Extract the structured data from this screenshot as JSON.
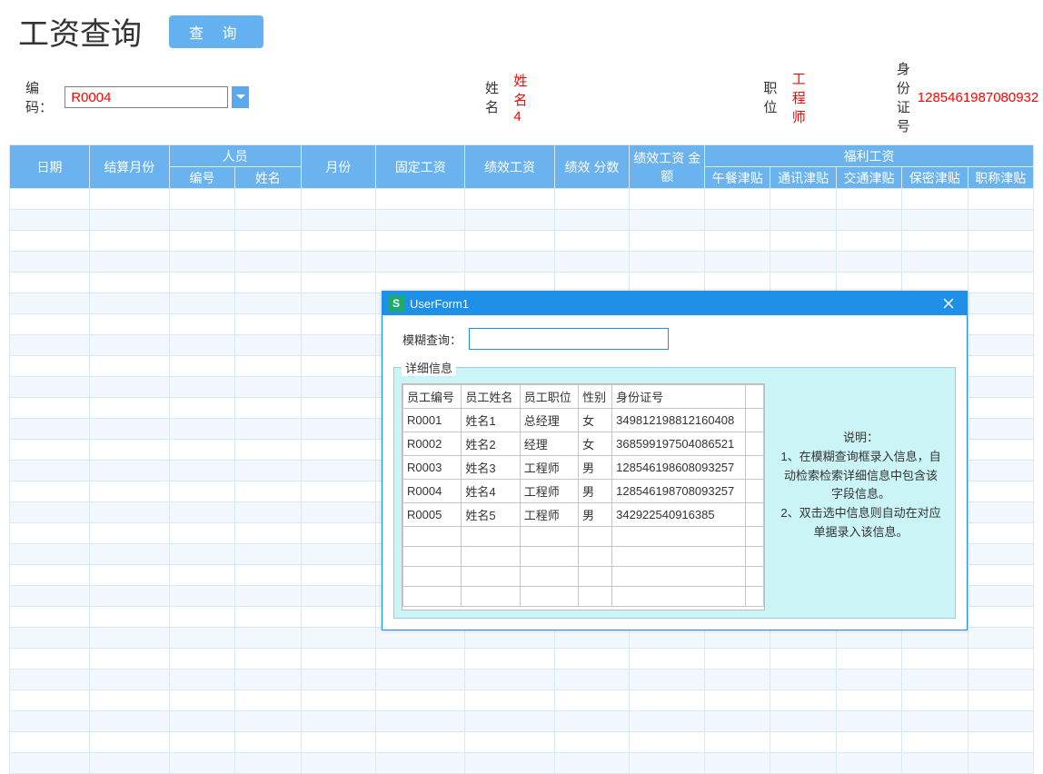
{
  "header": {
    "title": "工资查询",
    "query_button": "查  询"
  },
  "info": {
    "code_label": "编码：",
    "code_value": "R0004",
    "name_label": "姓名",
    "name_value": "姓名4",
    "role_label": "职位",
    "role_value": "工程师",
    "idno_label": "身份证号",
    "idno_value": "1285461987080932"
  },
  "grid": {
    "headers": {
      "date": "日期",
      "settle_month": "结算月份",
      "person": "人员",
      "person_id": "编号",
      "person_name": "姓名",
      "month": "月份",
      "fixed_salary": "固定工资",
      "perf_salary": "绩效工资",
      "perf_score": "绩效\n分数",
      "perf_amount": "绩效工资\n金额",
      "benefit_salary": "福利工资",
      "lunch": "午餐津贴",
      "comm": "通讯津贴",
      "transport": "交通津贴",
      "secret": "保密津贴",
      "title_allow": "职称津贴"
    },
    "empty_rows": 28
  },
  "dialog": {
    "title": "UserForm1",
    "icon_letter": "S",
    "fuzzy_label": "模糊查询：",
    "fuzzy_value": "",
    "detail_legend": "详细信息",
    "columns": [
      "员工编号",
      "员工姓名",
      "员工职位",
      "性别",
      "身份证号"
    ],
    "rows": [
      {
        "id": "R0001",
        "name": "姓名1",
        "role": "总经理",
        "sex": "女",
        "idno": "349812198812160408"
      },
      {
        "id": "R0002",
        "name": "姓名2",
        "role": "经理",
        "sex": "女",
        "idno": "368599197504086521"
      },
      {
        "id": "R0003",
        "name": "姓名3",
        "role": "工程师",
        "sex": "男",
        "idno": "128546198608093257"
      },
      {
        "id": "R0004",
        "name": "姓名4",
        "role": "工程师",
        "sex": "男",
        "idno": "128546198708093257"
      },
      {
        "id": "R0005",
        "name": "姓名5",
        "role": "工程师",
        "sex": "男",
        "idno": "342922540916385"
      }
    ],
    "blank_rows": 4,
    "help_title": "说明：",
    "help_line1": "1、在模糊查询框录入信息，自动检索检索详细信息中包含该字段信息。",
    "help_line2": "2、双击选中信息则自动在对应单据录入该信息。"
  }
}
